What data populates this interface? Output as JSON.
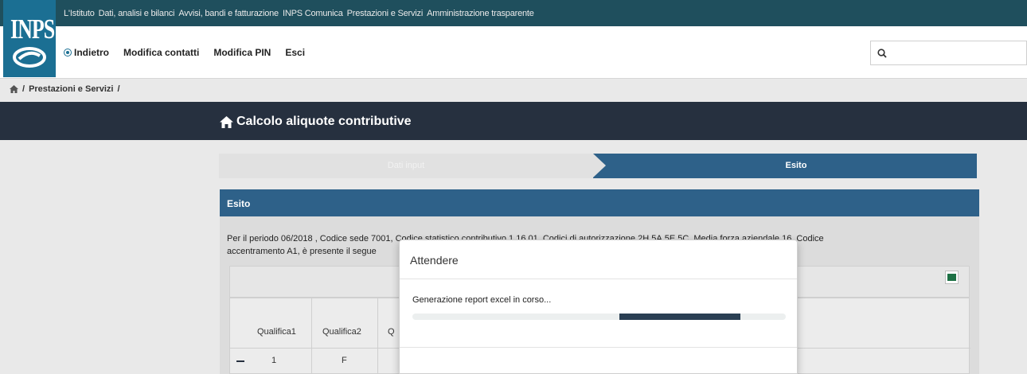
{
  "brand": {
    "logo_text": "INPS"
  },
  "top_nav": [
    "L'Istituto",
    "Dati, analisi e bilanci",
    "Avvisi, bandi e fatturazione",
    "INPS Comunica",
    "Prestazioni e Servizi",
    "Amministrazione trasparente"
  ],
  "sub_nav": {
    "back": "Indietro",
    "edit_contacts": "Modifica contatti",
    "edit_pin": "Modifica PIN",
    "logout": "Esci"
  },
  "breadcrumb": {
    "separator": "/",
    "item": "Prestazioni e Servizi"
  },
  "page": {
    "title": "Calcolo aliquote contributive"
  },
  "steps": {
    "step1": "Dati input",
    "step2": "Esito"
  },
  "panel": {
    "heading": "Esito",
    "text_line1": "Per il periodo 06/2018 , Codice sede 7001, Codice statistico contributivo 1.16.01, Codici di autorizzazione 2H,5A,5E,5C, Media forza aziendale 16, Codice",
    "text_line2": "accentramento A1, è presente il segue",
    "table_headers": [
      "Qualifica1",
      "Qualifica2",
      "Q"
    ],
    "row1": [
      "1",
      "F"
    ]
  },
  "modal": {
    "title": "Attendere",
    "message": "Generazione report excel in corso...",
    "progress_start": 0.555,
    "progress_end": 0.879
  },
  "colors": {
    "header": "#1f4f5d",
    "accent": "#2e6189",
    "dark": "#26303f"
  }
}
